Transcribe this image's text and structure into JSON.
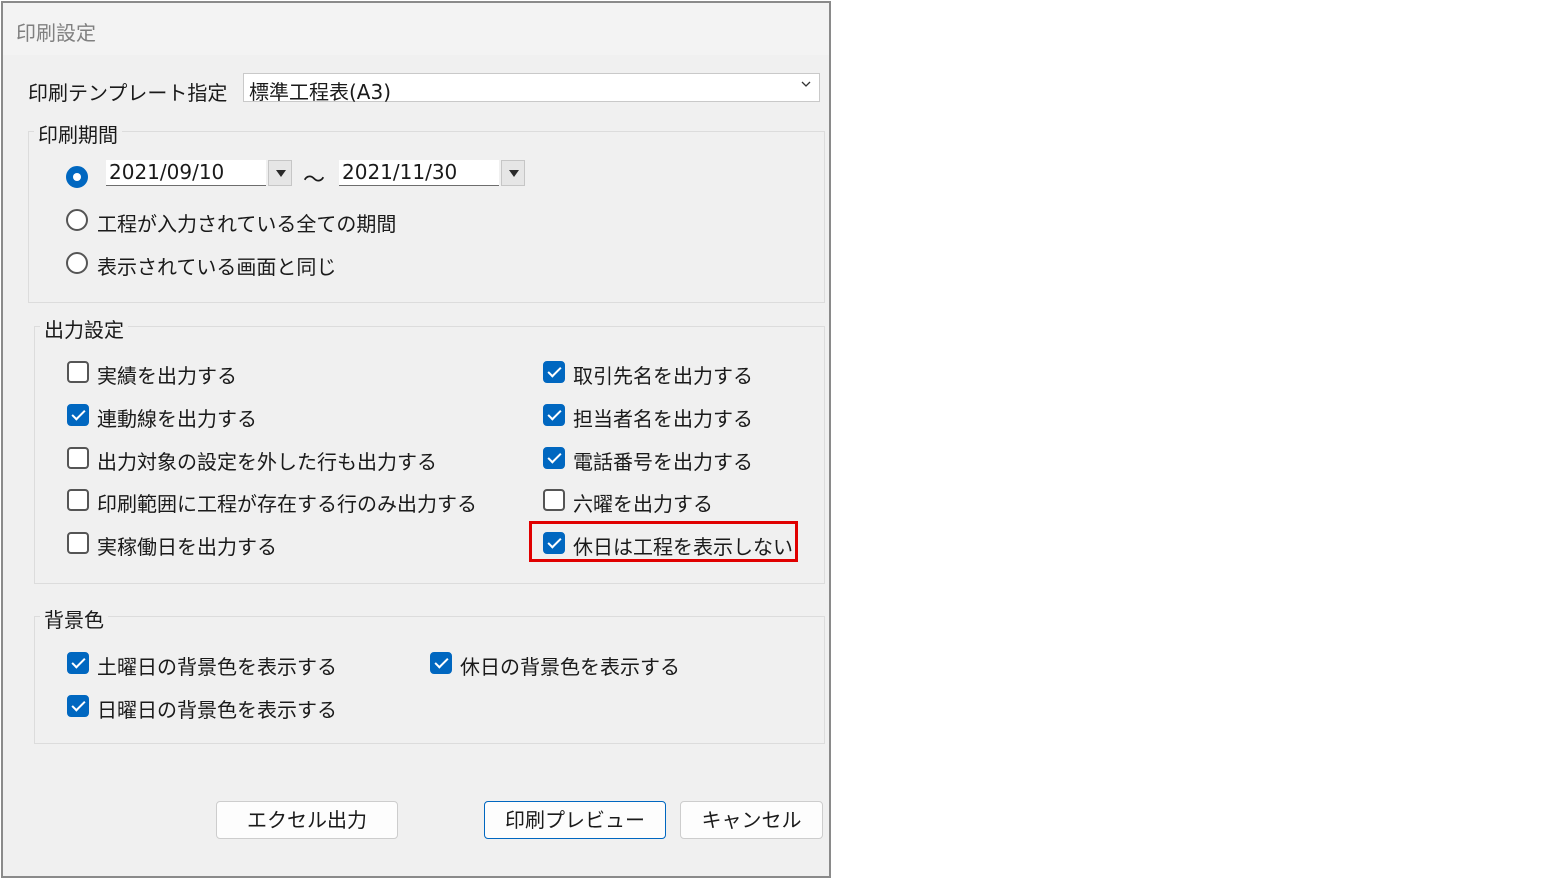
{
  "window": {
    "title": "印刷設定"
  },
  "template": {
    "label": "印刷テンプレート指定",
    "value": "標準工程表(A3)"
  },
  "print_period": {
    "title": "印刷期間",
    "date_from": "2021/09/10",
    "separator": "～",
    "date_to": "2021/11/30",
    "options": [
      {
        "label": "",
        "selected": true
      },
      {
        "label": "工程が入力されている全ての期間",
        "selected": false
      },
      {
        "label": "表示されている画面と同じ",
        "selected": false
      }
    ]
  },
  "output_settings": {
    "title": "出力設定",
    "left": [
      {
        "label": "実績を出力する",
        "checked": false
      },
      {
        "label": "連動線を出力する",
        "checked": true
      },
      {
        "label": "出力対象の設定を外した行も出力する",
        "checked": false
      },
      {
        "label": "印刷範囲に工程が存在する行のみ出力する",
        "checked": false
      },
      {
        "label": "実稼働日を出力する",
        "checked": false
      }
    ],
    "right": [
      {
        "label": "取引先名を出力する",
        "checked": true
      },
      {
        "label": "担当者名を出力する",
        "checked": true
      },
      {
        "label": "電話番号を出力する",
        "checked": true
      },
      {
        "label": "六曜を出力する",
        "checked": false
      },
      {
        "label": "休日は工程を表示しない",
        "checked": true,
        "highlighted": true
      }
    ]
  },
  "background": {
    "title": "背景色",
    "items": [
      {
        "label": "土曜日の背景色を表示する",
        "checked": true
      },
      {
        "label": "休日の背景色を表示する",
        "checked": true
      },
      {
        "label": "日曜日の背景色を表示する",
        "checked": true
      }
    ]
  },
  "buttons": {
    "excel": "エクセル出力",
    "preview": "印刷プレビュー",
    "cancel": "キャンセル"
  },
  "colors": {
    "accent": "#0067c0",
    "highlight": "#e00000"
  }
}
